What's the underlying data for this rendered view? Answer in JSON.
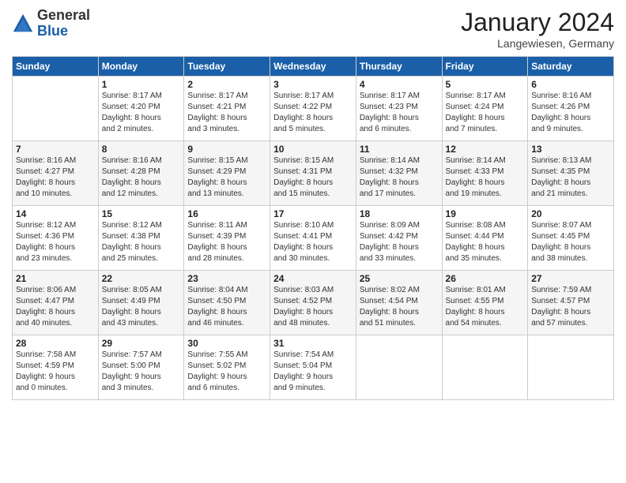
{
  "header": {
    "logo_general": "General",
    "logo_blue": "Blue",
    "month_title": "January 2024",
    "location": "Langewiesen, Germany"
  },
  "weekdays": [
    "Sunday",
    "Monday",
    "Tuesday",
    "Wednesday",
    "Thursday",
    "Friday",
    "Saturday"
  ],
  "weeks": [
    [
      {
        "day": "",
        "info": ""
      },
      {
        "day": "1",
        "info": "Sunrise: 8:17 AM\nSunset: 4:20 PM\nDaylight: 8 hours\nand 2 minutes."
      },
      {
        "day": "2",
        "info": "Sunrise: 8:17 AM\nSunset: 4:21 PM\nDaylight: 8 hours\nand 3 minutes."
      },
      {
        "day": "3",
        "info": "Sunrise: 8:17 AM\nSunset: 4:22 PM\nDaylight: 8 hours\nand 5 minutes."
      },
      {
        "day": "4",
        "info": "Sunrise: 8:17 AM\nSunset: 4:23 PM\nDaylight: 8 hours\nand 6 minutes."
      },
      {
        "day": "5",
        "info": "Sunrise: 8:17 AM\nSunset: 4:24 PM\nDaylight: 8 hours\nand 7 minutes."
      },
      {
        "day": "6",
        "info": "Sunrise: 8:16 AM\nSunset: 4:26 PM\nDaylight: 8 hours\nand 9 minutes."
      }
    ],
    [
      {
        "day": "7",
        "info": "Sunrise: 8:16 AM\nSunset: 4:27 PM\nDaylight: 8 hours\nand 10 minutes."
      },
      {
        "day": "8",
        "info": "Sunrise: 8:16 AM\nSunset: 4:28 PM\nDaylight: 8 hours\nand 12 minutes."
      },
      {
        "day": "9",
        "info": "Sunrise: 8:15 AM\nSunset: 4:29 PM\nDaylight: 8 hours\nand 13 minutes."
      },
      {
        "day": "10",
        "info": "Sunrise: 8:15 AM\nSunset: 4:31 PM\nDaylight: 8 hours\nand 15 minutes."
      },
      {
        "day": "11",
        "info": "Sunrise: 8:14 AM\nSunset: 4:32 PM\nDaylight: 8 hours\nand 17 minutes."
      },
      {
        "day": "12",
        "info": "Sunrise: 8:14 AM\nSunset: 4:33 PM\nDaylight: 8 hours\nand 19 minutes."
      },
      {
        "day": "13",
        "info": "Sunrise: 8:13 AM\nSunset: 4:35 PM\nDaylight: 8 hours\nand 21 minutes."
      }
    ],
    [
      {
        "day": "14",
        "info": "Sunrise: 8:12 AM\nSunset: 4:36 PM\nDaylight: 8 hours\nand 23 minutes."
      },
      {
        "day": "15",
        "info": "Sunrise: 8:12 AM\nSunset: 4:38 PM\nDaylight: 8 hours\nand 25 minutes."
      },
      {
        "day": "16",
        "info": "Sunrise: 8:11 AM\nSunset: 4:39 PM\nDaylight: 8 hours\nand 28 minutes."
      },
      {
        "day": "17",
        "info": "Sunrise: 8:10 AM\nSunset: 4:41 PM\nDaylight: 8 hours\nand 30 minutes."
      },
      {
        "day": "18",
        "info": "Sunrise: 8:09 AM\nSunset: 4:42 PM\nDaylight: 8 hours\nand 33 minutes."
      },
      {
        "day": "19",
        "info": "Sunrise: 8:08 AM\nSunset: 4:44 PM\nDaylight: 8 hours\nand 35 minutes."
      },
      {
        "day": "20",
        "info": "Sunrise: 8:07 AM\nSunset: 4:45 PM\nDaylight: 8 hours\nand 38 minutes."
      }
    ],
    [
      {
        "day": "21",
        "info": "Sunrise: 8:06 AM\nSunset: 4:47 PM\nDaylight: 8 hours\nand 40 minutes."
      },
      {
        "day": "22",
        "info": "Sunrise: 8:05 AM\nSunset: 4:49 PM\nDaylight: 8 hours\nand 43 minutes."
      },
      {
        "day": "23",
        "info": "Sunrise: 8:04 AM\nSunset: 4:50 PM\nDaylight: 8 hours\nand 46 minutes."
      },
      {
        "day": "24",
        "info": "Sunrise: 8:03 AM\nSunset: 4:52 PM\nDaylight: 8 hours\nand 48 minutes."
      },
      {
        "day": "25",
        "info": "Sunrise: 8:02 AM\nSunset: 4:54 PM\nDaylight: 8 hours\nand 51 minutes."
      },
      {
        "day": "26",
        "info": "Sunrise: 8:01 AM\nSunset: 4:55 PM\nDaylight: 8 hours\nand 54 minutes."
      },
      {
        "day": "27",
        "info": "Sunrise: 7:59 AM\nSunset: 4:57 PM\nDaylight: 8 hours\nand 57 minutes."
      }
    ],
    [
      {
        "day": "28",
        "info": "Sunrise: 7:58 AM\nSunset: 4:59 PM\nDaylight: 9 hours\nand 0 minutes."
      },
      {
        "day": "29",
        "info": "Sunrise: 7:57 AM\nSunset: 5:00 PM\nDaylight: 9 hours\nand 3 minutes."
      },
      {
        "day": "30",
        "info": "Sunrise: 7:55 AM\nSunset: 5:02 PM\nDaylight: 9 hours\nand 6 minutes."
      },
      {
        "day": "31",
        "info": "Sunrise: 7:54 AM\nSunset: 5:04 PM\nDaylight: 9 hours\nand 9 minutes."
      },
      {
        "day": "",
        "info": ""
      },
      {
        "day": "",
        "info": ""
      },
      {
        "day": "",
        "info": ""
      }
    ]
  ]
}
